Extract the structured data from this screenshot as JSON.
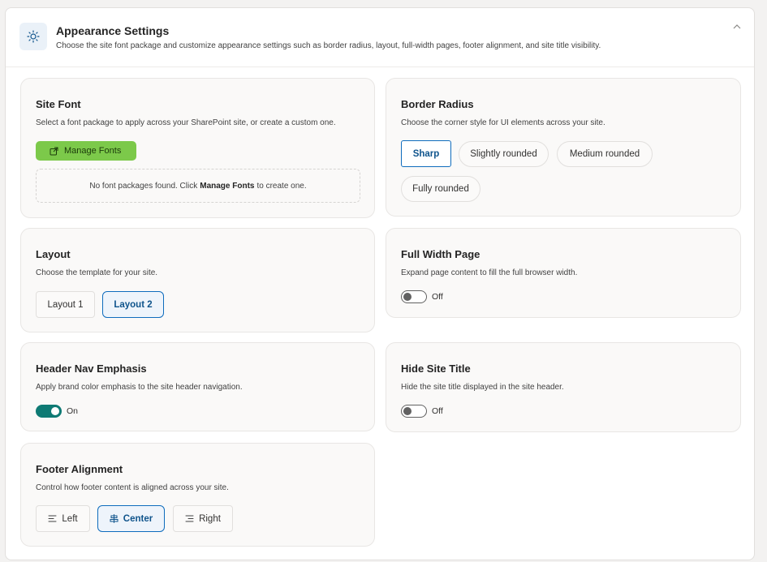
{
  "header": {
    "title": "Appearance Settings",
    "description": "Choose the site font package and customize appearance settings such as border radius, layout, full-width pages, footer alignment, and site title visibility."
  },
  "site_font": {
    "title": "Site Font",
    "description": "Select a font package to apply across your SharePoint site, or create a custom one.",
    "manage_label": "Manage Fonts",
    "empty_before": "No font packages found. Click",
    "empty_bold": "Manage Fonts",
    "empty_after": "to create one."
  },
  "border_radius": {
    "title": "Border Radius",
    "description": "Choose the corner style for UI elements across your site.",
    "options": [
      "Sharp",
      "Slightly rounded",
      "Medium rounded",
      "Fully rounded"
    ],
    "selected": "Sharp"
  },
  "layout": {
    "title": "Layout",
    "description": "Choose the template for your site.",
    "options": [
      "Layout 1",
      "Layout 2"
    ],
    "selected": "Layout 2"
  },
  "full_width": {
    "title": "Full Width Page",
    "description": "Expand page content to fill the full browser width.",
    "state": "Off"
  },
  "header_nav": {
    "title": "Header Nav Emphasis",
    "description": "Apply brand color emphasis to the site header navigation.",
    "state": "On"
  },
  "hide_title": {
    "title": "Hide Site Title",
    "description": "Hide the site title displayed in the site header.",
    "state": "Off"
  },
  "footer": {
    "title": "Footer Alignment",
    "description": "Control how footer content is aligned across your site.",
    "options": [
      "Left",
      "Center",
      "Right"
    ],
    "selected": "Center"
  },
  "colors": {
    "accent": "#0f6cbd",
    "manage_button": "#7cc94a",
    "toggle_on": "#0e7a74"
  },
  "icons": [
    "sun-icon",
    "chevron-up-icon",
    "open-external-icon",
    "align-left-icon",
    "align-center-icon",
    "align-right-icon"
  ]
}
